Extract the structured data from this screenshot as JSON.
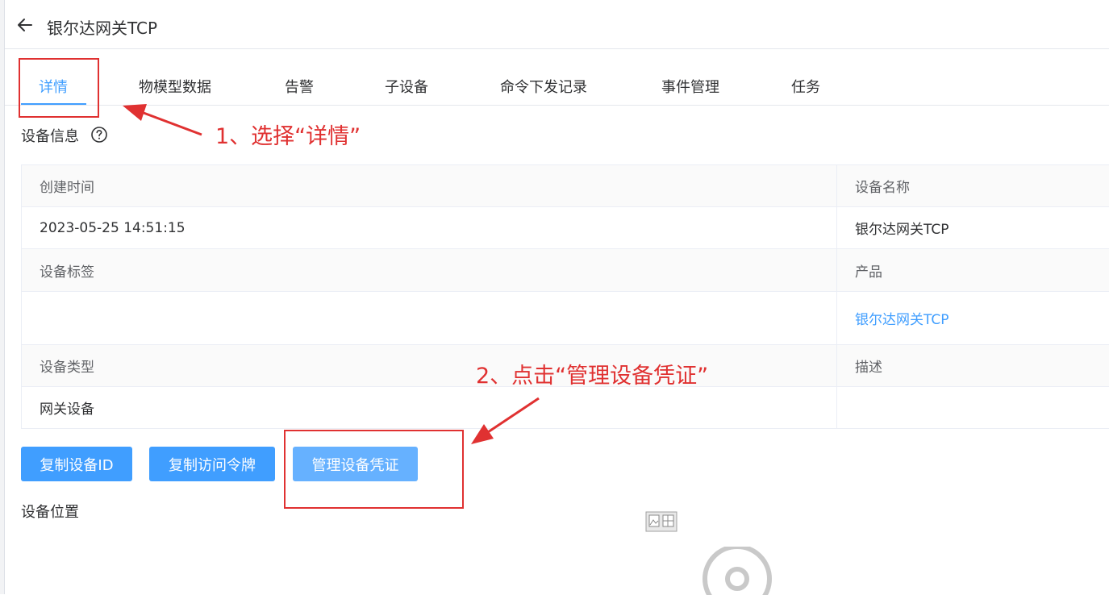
{
  "header": {
    "back_icon": "arrow-left-icon",
    "title": "银尔达网关TCP"
  },
  "tabs": [
    {
      "label": "详情",
      "active": true
    },
    {
      "label": "物模型数据"
    },
    {
      "label": "告警"
    },
    {
      "label": "子设备"
    },
    {
      "label": "命令下发记录"
    },
    {
      "label": "事件管理"
    },
    {
      "label": "任务"
    }
  ],
  "device_info": {
    "section_title": "设备信息",
    "help_icon": "question-circle-icon",
    "fields": {
      "created_time": {
        "label": "创建时间",
        "value": "2023-05-25 14:51:15"
      },
      "device_name": {
        "label": "设备名称",
        "value": "银尔达网关TCP"
      },
      "device_tags": {
        "label": "设备标签",
        "value": ""
      },
      "product": {
        "label": "产品",
        "value": "银尔达网关TCP"
      },
      "device_type": {
        "label": "设备类型",
        "value": "网关设备"
      },
      "description": {
        "label": "描述",
        "value": ""
      }
    }
  },
  "actions": {
    "copy_device_id": "复制设备ID",
    "copy_access_token": "复制访问令牌",
    "manage_credentials": "管理设备凭证"
  },
  "location": {
    "title": "设备位置",
    "image_icon": "broken-image-icon",
    "loading_icon": "loading-circle-icon"
  },
  "annotations": {
    "step1": "1、选择“详情”",
    "step2": "2、点击“管理设备凭证”"
  },
  "colors": {
    "accent": "#409eff",
    "accent_light": "#66b1ff",
    "annotation": "#e03131"
  }
}
